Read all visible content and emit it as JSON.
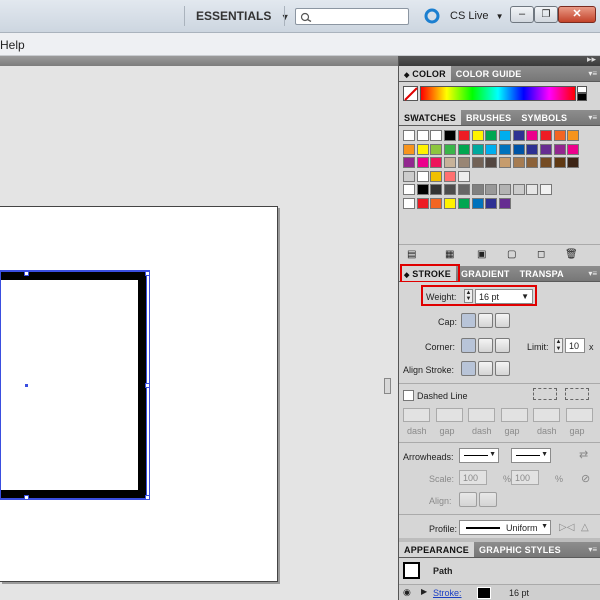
{
  "titlebar": {
    "workspace_label": "ESSENTIALS",
    "search_placeholder": "",
    "cslive_label": "CS Live",
    "controls": {
      "minimize": "–",
      "restore": "❐",
      "close": "✕"
    }
  },
  "menubar": {
    "items": [
      "Help"
    ]
  },
  "panels": {
    "color": {
      "tabs": [
        "COLOR",
        "COLOR GUIDE"
      ]
    },
    "swatches": {
      "tabs": [
        "SWATCHES",
        "BRUSHES",
        "SYMBOLS"
      ]
    },
    "stroke": {
      "tabs": [
        "STROKE",
        "GRADIENT",
        "TRANSPA"
      ],
      "weight_label": "Weight:",
      "weight_value": "16 pt",
      "cap_label": "Cap:",
      "corner_label": "Corner:",
      "limit_label": "Limit:",
      "limit_value": "10",
      "limit_unit": "x",
      "align_label": "Align Stroke:",
      "dashed_label": "Dashed Line",
      "dash_labels": [
        "dash",
        "gap",
        "dash",
        "gap",
        "dash",
        "gap"
      ],
      "arrowheads_label": "Arrowheads:",
      "scale_label": "Scale:",
      "scale_start": "100",
      "scale_end": "100",
      "percent": "%",
      "align_arrow_label": "Align:",
      "profile_label": "Profile:",
      "profile_value": "Uniform"
    },
    "appearance": {
      "tabs": [
        "APPEARANCE",
        "GRAPHIC STYLES"
      ],
      "path_label": "Path",
      "stroke_label": "Stroke:",
      "stroke_value": "16 pt"
    }
  },
  "colors": {
    "accent_red": "#e00000",
    "selection_blue": "#3a4ee0"
  },
  "swatch_rows": [
    [
      "#ffffff",
      "#ffffff",
      "#ffffff",
      "#000000",
      "#ed1c24",
      "#fff200",
      "#00a651",
      "#00aeef",
      "#2e3192",
      "#ec008c",
      "#ed1c24",
      "#f26522",
      "#f7941d"
    ],
    [
      "#f7941d",
      "#fff200",
      "#8dc63f",
      "#39b54a",
      "#00a651",
      "#00a99d",
      "#00aeef",
      "#0072bc",
      "#0054a6",
      "#2e3192",
      "#662d91",
      "#92278f",
      "#ec008c"
    ],
    [
      "#92278f",
      "#ec008c",
      "#ed145b",
      "#c7b299",
      "#998675",
      "#736357",
      "#534741",
      "#c69c6d",
      "#a67c52",
      "#8c6239",
      "#754c24",
      "#603913",
      "#3c2415"
    ],
    [
      "#cccccc",
      "#ffffff",
      "#f0c000",
      "#ff7070",
      "#eeeeee"
    ],
    [
      "#ffffff",
      "#000000",
      "#333333",
      "#4d4d4d",
      "#666666",
      "#808080",
      "#999999",
      "#b3b3b3",
      "#cccccc",
      "#e6e6e6",
      "#f2f2f2"
    ],
    [
      "#ffffff",
      "#ed1c24",
      "#f26522",
      "#fff200",
      "#00a651",
      "#0072bc",
      "#2e3192",
      "#662d91"
    ]
  ]
}
